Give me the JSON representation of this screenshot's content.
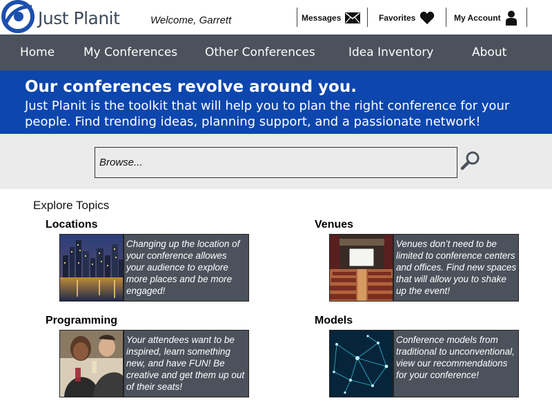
{
  "header": {
    "brand": "Just Planit",
    "welcome": "Welcome, Garrett",
    "messages_label": "Messages",
    "favorites_label": "Favorites",
    "account_label": "My Account"
  },
  "nav": {
    "items": [
      "Home",
      "My Conferences",
      "Other Conferences",
      "Idea Inventory",
      "About"
    ]
  },
  "hero": {
    "title": "Our conferences revolve around you.",
    "body": "Just Planit is the toolkit that will help you to plan the right conference for your people. Find trending ideas, planning support, and a passionate network!"
  },
  "search": {
    "placeholder": "Browse..."
  },
  "explore": {
    "heading": "Explore Topics",
    "topics": [
      {
        "title": "Locations",
        "description": "Changing up the location of your conference allowes your audience to explore more places and be more engaged!"
      },
      {
        "title": "Venues",
        "description": "Venues don’t need to be limited to conference centers and offices. Find new spaces that will allow you to shake up the event!"
      },
      {
        "title": "Programming",
        "description": "Your attendees want to be inspired, learn something new, and have FUN! Be creative and get them up out of their seats!"
      },
      {
        "title": "Models",
        "description": "Conference models from traditional to unconventional, view our recommendations for your conference!"
      }
    ]
  },
  "colors": {
    "nav_bg": "#4b525c",
    "hero_bg": "#0d46ad",
    "search_bg": "#ebebeb",
    "card_bg": "#4b525c"
  }
}
